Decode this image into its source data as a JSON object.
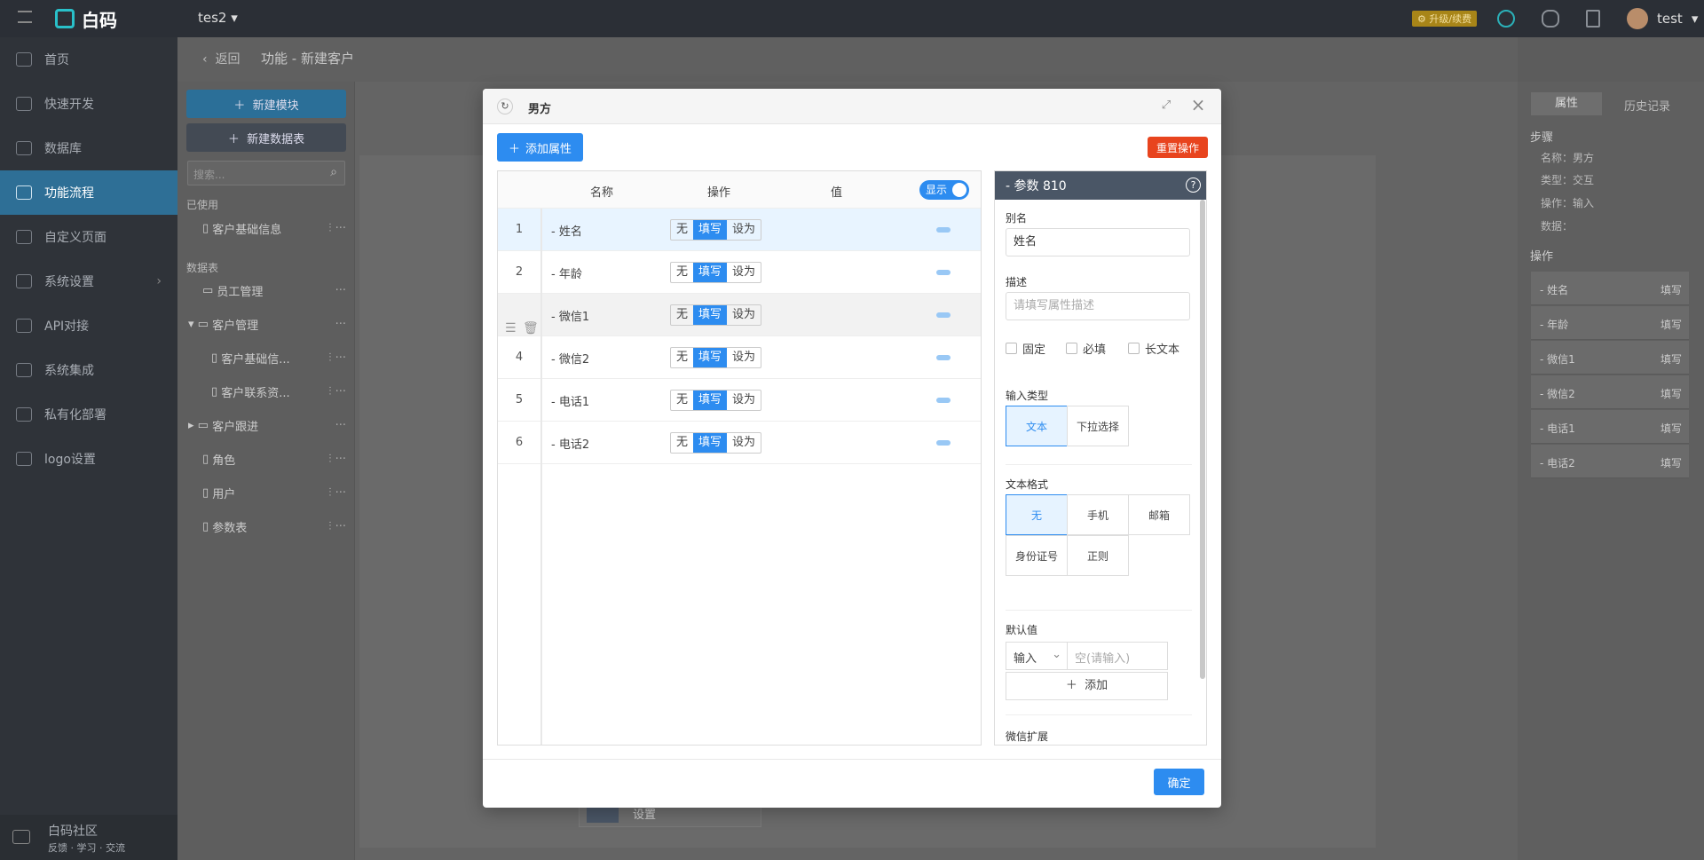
{
  "topbar": {
    "brand": "白码",
    "project": "tes2",
    "upgrade": "升级/续费",
    "username": "test"
  },
  "sidebar": {
    "items": [
      {
        "label": "首页",
        "icon": "home-icon"
      },
      {
        "label": "快速开发",
        "icon": "cube-icon"
      },
      {
        "label": "数据库",
        "icon": "database-icon"
      },
      {
        "label": "功能流程",
        "icon": "flow-icon"
      },
      {
        "label": "自定义页面",
        "icon": "page-icon"
      },
      {
        "label": "系统设置",
        "icon": "settings-icon"
      },
      {
        "label": "API对接",
        "icon": "api-icon"
      },
      {
        "label": "系统集成",
        "icon": "layers-icon"
      },
      {
        "label": "私有化部署",
        "icon": "lock-icon"
      },
      {
        "label": "logo设置",
        "icon": "logo-icon"
      }
    ],
    "community_title": "白码社区",
    "community_sub": "反馈 · 学习 · 交流"
  },
  "header": {
    "back": "返回",
    "title": "功能 - 新建客户"
  },
  "tree": {
    "new_module": "新建模块",
    "new_table": "新建数据表",
    "search_placeholder": "搜索...",
    "used_label": "已使用",
    "tables_label": "数据表",
    "used_items": [
      "客户基础信息"
    ],
    "items": [
      "员工管理",
      "客户管理",
      "客户基础信...",
      "客户联系资...",
      "客户跟进",
      "角色",
      "用户",
      "参数表"
    ]
  },
  "canvas_node": "设置",
  "right_panel": {
    "tabs": [
      "属性",
      "历史记录"
    ],
    "steps_title": "步骤",
    "step_name": "名称：男方",
    "step_type": "类型：交互",
    "step_op": "操作：输入",
    "step_data": "数据：",
    "ops_title": "操作",
    "ops": [
      {
        "name": "- 姓名",
        "val": "填写"
      },
      {
        "name": "- 年龄",
        "val": "填写"
      },
      {
        "name": "- 微信1",
        "val": "填写"
      },
      {
        "name": "- 微信2",
        "val": "填写"
      },
      {
        "name": "- 电话1",
        "val": "填写"
      },
      {
        "name": "- 电话2",
        "val": "填写"
      }
    ]
  },
  "modal": {
    "title": "男方",
    "add_attr": "添加属性",
    "reset": "重置操作",
    "ok": "确定",
    "columns": {
      "name": "名称",
      "op": "操作",
      "value": "值"
    },
    "toggle_label": "显示",
    "op_options": [
      "无",
      "填写",
      "设为"
    ],
    "rows": [
      {
        "num": "1",
        "name": "- 姓名"
      },
      {
        "num": "2",
        "name": "- 年龄"
      },
      {
        "num": "",
        "name": "- 微信1"
      },
      {
        "num": "4",
        "name": "- 微信2"
      },
      {
        "num": "5",
        "name": "- 电话1"
      },
      {
        "num": "6",
        "name": "- 电话2"
      }
    ]
  },
  "param": {
    "title": "- 参数 810",
    "alias_label": "别名",
    "alias_value": "姓名",
    "desc_label": "描述",
    "desc_placeholder": "请填写属性描述",
    "chk_fixed": "固定",
    "chk_required": "必填",
    "chk_long": "长文本",
    "input_type_label": "输入类型",
    "input_types": [
      "文本",
      "下拉选择"
    ],
    "text_format_label": "文本格式",
    "text_formats": [
      "无",
      "手机",
      "邮箱",
      "身份证号",
      "正则"
    ],
    "default_label": "默认值",
    "default_mode": "输入",
    "default_placeholder": "空(请输入)",
    "add": "添加",
    "wechat_ext": "微信扩展"
  }
}
